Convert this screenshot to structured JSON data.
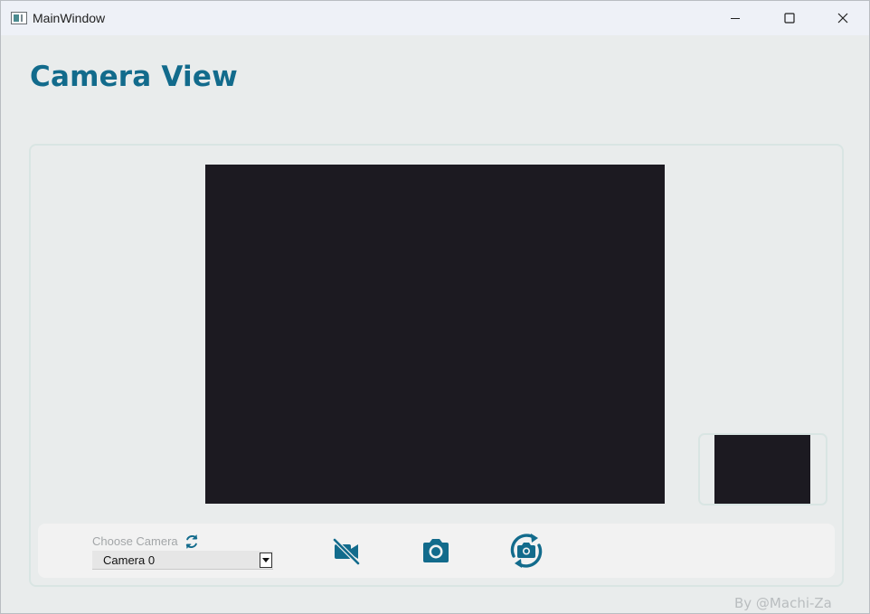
{
  "window": {
    "title": "MainWindow",
    "icons": {
      "app": "window-app-icon",
      "minimize": "minimize-icon",
      "maximize": "maximize-icon",
      "close": "close-icon"
    }
  },
  "header": {
    "title": "Camera View"
  },
  "colors": {
    "accent": "#126b8c",
    "video_bg": "#1c1a21",
    "panel_border": "#d9e5e3",
    "muted_text": "#a3a6a8",
    "background": "#e9ecec"
  },
  "controls": {
    "choose_label": "Choose Camera",
    "refresh_icon": "refresh-icon",
    "camera_select": {
      "value": "Camera 0"
    },
    "buttons": [
      {
        "name": "camera-off-button",
        "icon": "video-off-icon"
      },
      {
        "name": "capture-photo-button",
        "icon": "camera-icon"
      },
      {
        "name": "switch-camera-button",
        "icon": "camera-rotate-icon"
      }
    ]
  },
  "footer": {
    "credit": "By @Machi-Za"
  }
}
